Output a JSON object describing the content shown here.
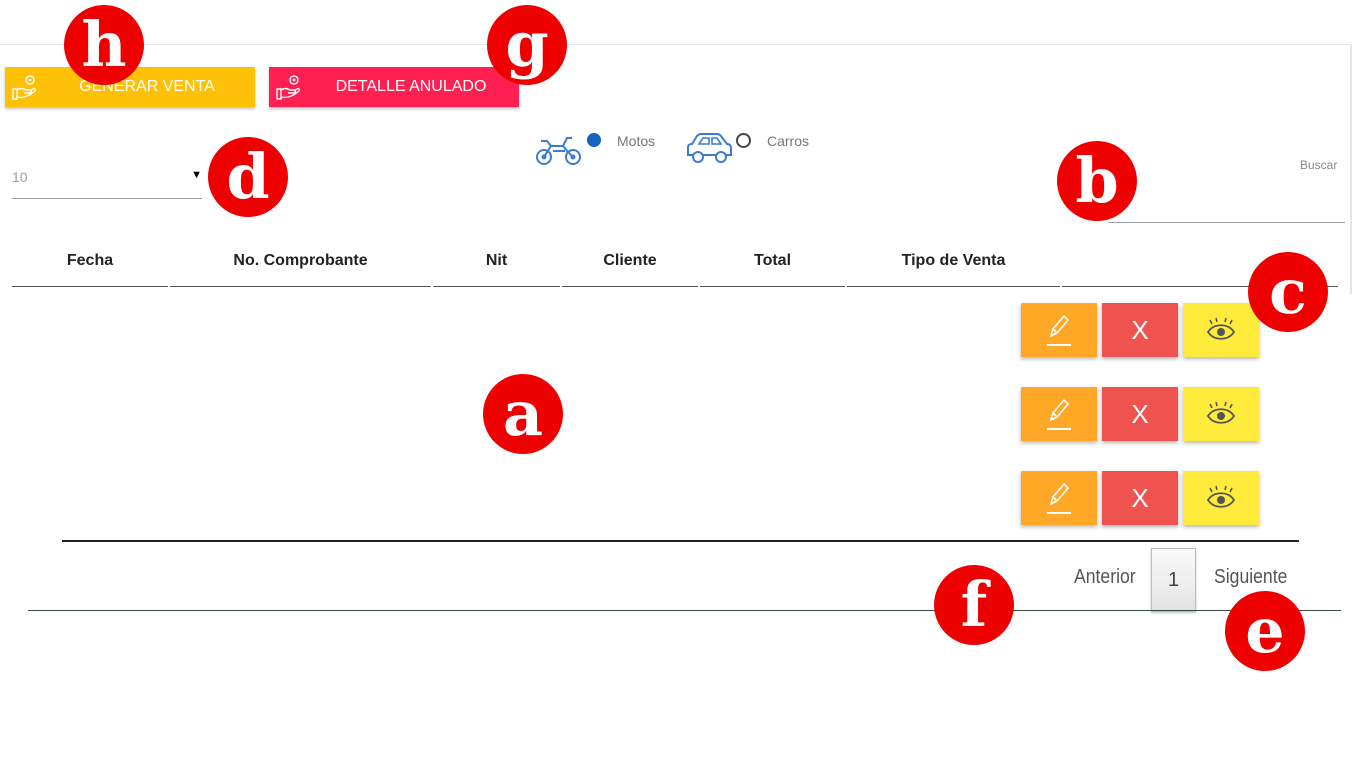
{
  "toolbar": {
    "generar_label": "GENERAR VENTA",
    "detalle_label": "DETALLE ANULADO"
  },
  "page_size": {
    "value": "10"
  },
  "vehicle_filter": {
    "motos_label": "Motos",
    "carros_label": "Carros",
    "selected": "Motos"
  },
  "search": {
    "label": "Buscar",
    "value": ""
  },
  "table": {
    "headers": [
      "Fecha",
      "No. Comprobante",
      "Nit",
      "Cliente",
      "Total",
      "Tipo de Venta",
      ""
    ],
    "rows": [
      {
        "actions": {
          "edit_icon": "pencil-icon",
          "delete_label": "X",
          "view_icon": "eye-icon"
        }
      },
      {
        "actions": {
          "edit_icon": "pencil-icon",
          "delete_label": "X",
          "view_icon": "eye-icon"
        }
      },
      {
        "actions": {
          "edit_icon": "pencil-icon",
          "delete_label": "X",
          "view_icon": "eye-icon"
        }
      }
    ]
  },
  "pagination": {
    "previous_label": "Anterior",
    "current_page": "1",
    "next_label": "Siguiente"
  },
  "markers": {
    "a": "a",
    "b": "b",
    "c": "c",
    "d": "d",
    "e": "e",
    "f": "f",
    "g": "g",
    "h": "h"
  },
  "colors": {
    "generar": "#ffc107",
    "detalle": "#ff1f50",
    "edit": "#ffa726",
    "delete": "#ef5350",
    "view": "#ffeb3b",
    "radio_selected": "#1565c0",
    "vehicle_icon": "#3a7bd5",
    "marker": "#ee0000"
  }
}
